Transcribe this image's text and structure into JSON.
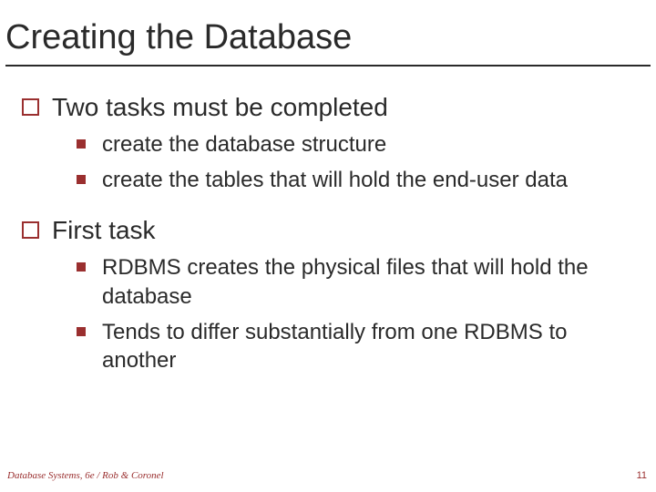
{
  "title": "Creating the Database",
  "points": [
    {
      "text": "Two tasks must be completed",
      "subs": [
        "create the database structure",
        "create the tables that will hold the end-user data"
      ]
    },
    {
      "text": "First task",
      "subs": [
        "RDBMS creates the physical files that will hold the database",
        "Tends to differ substantially from one RDBMS to another"
      ]
    }
  ],
  "footer_left": "Database Systems, 6e / Rob & Coronel",
  "footer_right": "11"
}
